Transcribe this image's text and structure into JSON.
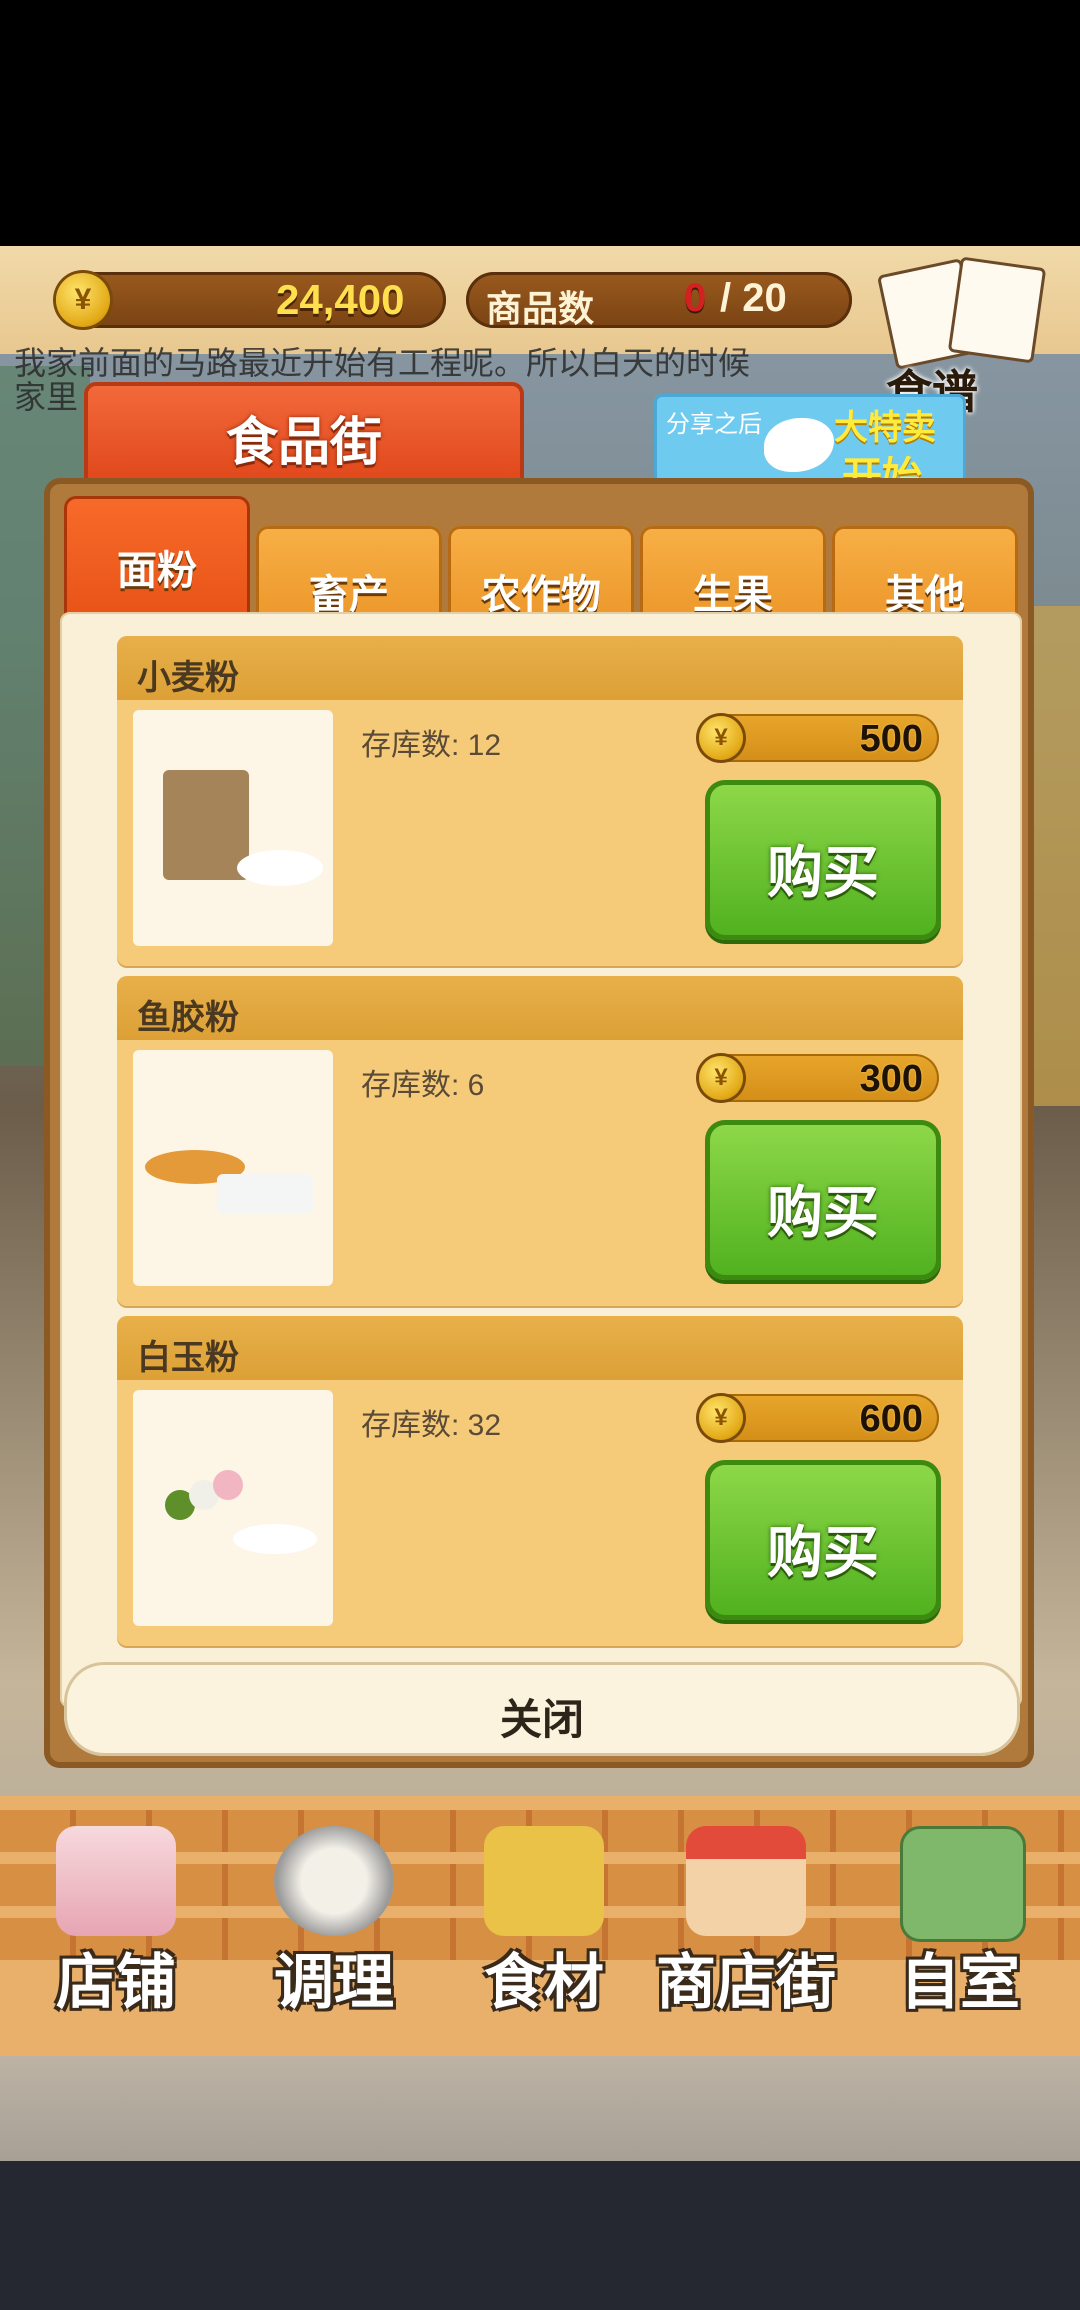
{
  "hud": {
    "money": "24,400",
    "goods_label": "商品数",
    "goods_count": "0",
    "goods_max": "/ 20",
    "currency_icon": "yen-coin-icon",
    "ticker_line1": "我家前面的马路最近开始有工程呢。所以白天的时候",
    "ticker_line2": "家里"
  },
  "recipe": {
    "label": "食谱",
    "icon": "recipe-book-icon"
  },
  "share": {
    "small": "分享之后",
    "big1": "大特卖",
    "big2": "开始",
    "icon": "twitter-bird-icon"
  },
  "shop": {
    "title": "食品街"
  },
  "tabs": [
    {
      "label": "面粉"
    },
    {
      "label": "畜产"
    },
    {
      "label": "农作物"
    },
    {
      "label": "生果"
    },
    {
      "label": "其他"
    }
  ],
  "items": [
    {
      "name": "小麦粉",
      "stock_label": "存库数: 12",
      "price": "500",
      "buy": "购买",
      "image": "flour-bag-icon"
    },
    {
      "name": "鱼胶粉",
      "stock_label": "存库数: 6",
      "price": "300",
      "buy": "购买",
      "image": "gelatin-powder-icon"
    },
    {
      "name": "白玉粉",
      "stock_label": "存库数: 32",
      "price": "600",
      "buy": "购买",
      "image": "dango-powder-icon"
    }
  ],
  "close_label": "关闭",
  "nav": [
    {
      "label": "店铺",
      "icon": "cake-icon"
    },
    {
      "label": "调理",
      "icon": "mixing-bowl-icon"
    },
    {
      "label": "食材",
      "icon": "ingredient-bag-icon"
    },
    {
      "label": "商店街",
      "icon": "storefront-icon"
    },
    {
      "label": "自室",
      "icon": "staff-only-bag-icon"
    }
  ],
  "colors": {
    "accent_orange": "#e54c12",
    "buy_green": "#4fb01e",
    "price_gold": "#d48e18",
    "hud_brown": "#7a4313"
  }
}
